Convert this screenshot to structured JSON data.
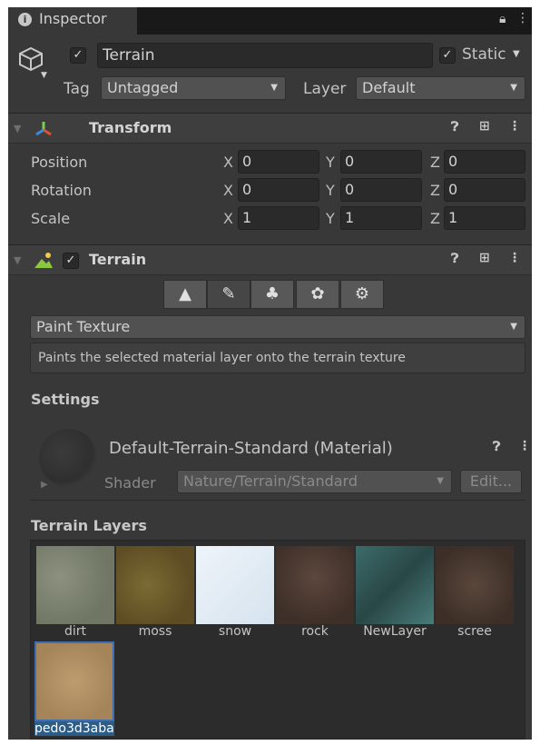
{
  "panel": {
    "tab_title": "Inspector"
  },
  "object": {
    "active": true,
    "name": "Terrain",
    "static_checked": true,
    "static_label": "Static",
    "tag_label": "Tag",
    "tag_value": "Untagged",
    "layer_label": "Layer",
    "layer_value": "Default"
  },
  "transform": {
    "title": "Transform",
    "rows": [
      {
        "label": "Position",
        "x": "0",
        "y": "0",
        "z": "0"
      },
      {
        "label": "Rotation",
        "x": "0",
        "y": "0",
        "z": "0"
      },
      {
        "label": "Scale",
        "x": "1",
        "y": "1",
        "z": "1"
      }
    ],
    "axis_labels": {
      "x": "X",
      "y": "Y",
      "z": "Z"
    }
  },
  "terrain": {
    "title": "Terrain",
    "enabled": true,
    "tool_icons": [
      "raise-terrain-icon",
      "paint-brush-icon",
      "tree-icon",
      "detail-flowers-icon",
      "gear-icon"
    ],
    "active_tool": 1,
    "mode_value": "Paint Texture",
    "help_text": "Paints the selected material layer onto the terrain texture",
    "settings_label": "Settings",
    "material": {
      "name": "Default-Terrain-Standard (Material)",
      "shader_label": "Shader",
      "shader_value": "Nature/Terrain/Standard",
      "edit_label": "Edit..."
    },
    "layers_label": "Terrain Layers",
    "layers": [
      {
        "name": "dirt",
        "color": "#7c8270"
      },
      {
        "name": "moss",
        "color": "#6b5b2a"
      },
      {
        "name": "snow",
        "color": "#dfe9f2"
      },
      {
        "name": "rock",
        "color": "#4f3c33"
      },
      {
        "name": "NewLayer",
        "color": "#2f5a5a"
      },
      {
        "name": "scree",
        "color": "#4e3e34"
      },
      {
        "name": "pedo3d3aba",
        "color": "#b08e63"
      }
    ],
    "selected_layer": 6
  },
  "colors": {
    "panel_bg": "#383838",
    "header_bg": "#3e3e3e",
    "field_bg": "#2a2a2a",
    "selection": "#2c5d87"
  }
}
